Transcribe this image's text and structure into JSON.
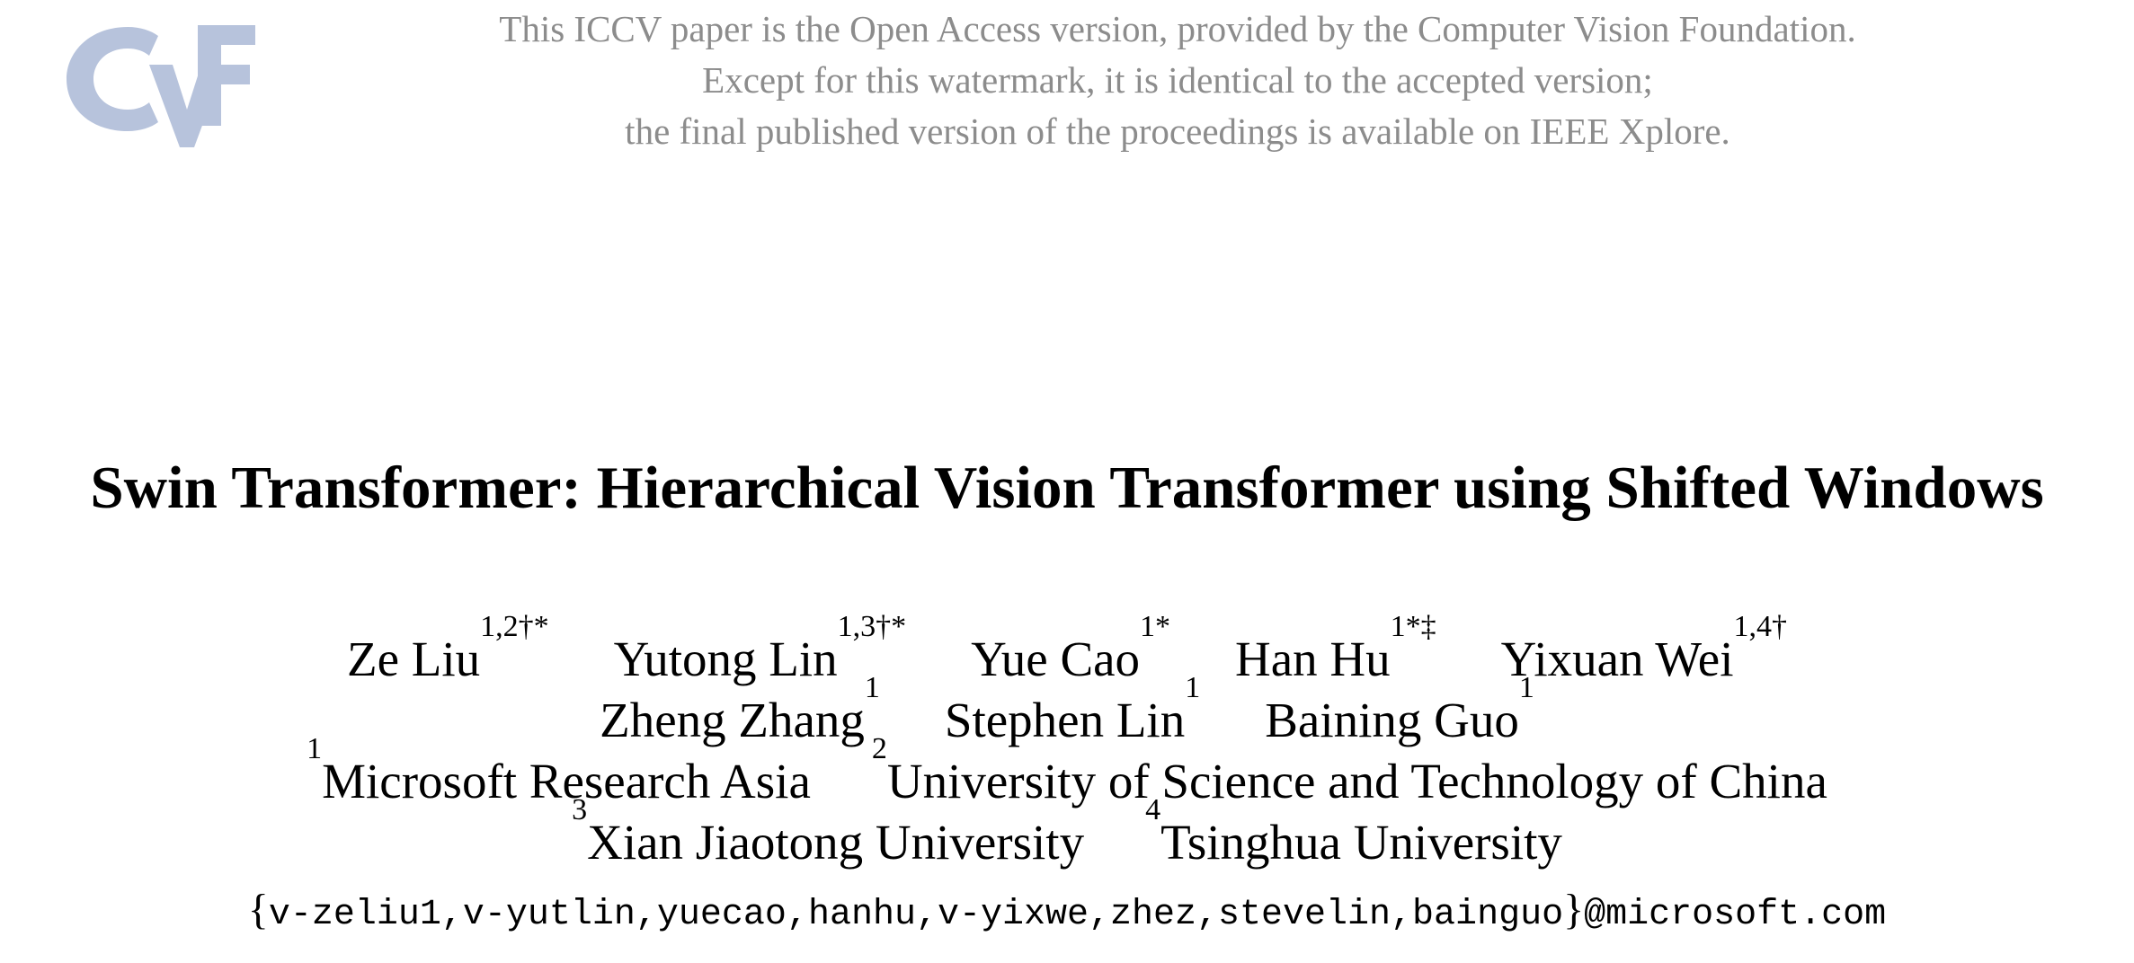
{
  "logo": {
    "text": "CvF",
    "color": "#b7c3dc"
  },
  "watermark": {
    "line1": "This ICCV paper is the Open Access version, provided by the Computer Vision Foundation.",
    "line2": "Except for this watermark, it is identical to the accepted version;",
    "line3": "the final published version of the proceedings is available on IEEE Xplore."
  },
  "title": "Swin Transformer: Hierarchical Vision Transformer using Shifted Windows",
  "authors_row1": [
    {
      "name": "Ze Liu",
      "sup": "1,2†*"
    },
    {
      "name": "Yutong Lin",
      "sup": "1,3†*"
    },
    {
      "name": "Yue Cao",
      "sup": "1*"
    },
    {
      "name": "Han Hu",
      "sup": "1*‡"
    },
    {
      "name": "Yixuan Wei",
      "sup": "1,4†"
    }
  ],
  "authors_row2": [
    {
      "name": "Zheng Zhang",
      "sup": "1"
    },
    {
      "name": "Stephen Lin",
      "sup": "1"
    },
    {
      "name": "Baining Guo",
      "sup": "1"
    }
  ],
  "affiliations_row1": [
    {
      "num": "1",
      "name": "Microsoft Research Asia"
    },
    {
      "num": "2",
      "name": "University of Science and Technology of China"
    }
  ],
  "affiliations_row2": [
    {
      "num": "3",
      "name": "Xian Jiaotong University"
    },
    {
      "num": "4",
      "name": "Tsinghua University"
    }
  ],
  "email": {
    "open": "{",
    "ids": "v-zeliu1,v-yutlin,yuecao,hanhu,v-yixwe,zhez,stevelin,bainguo",
    "close": "}",
    "domain": "@microsoft.com"
  }
}
